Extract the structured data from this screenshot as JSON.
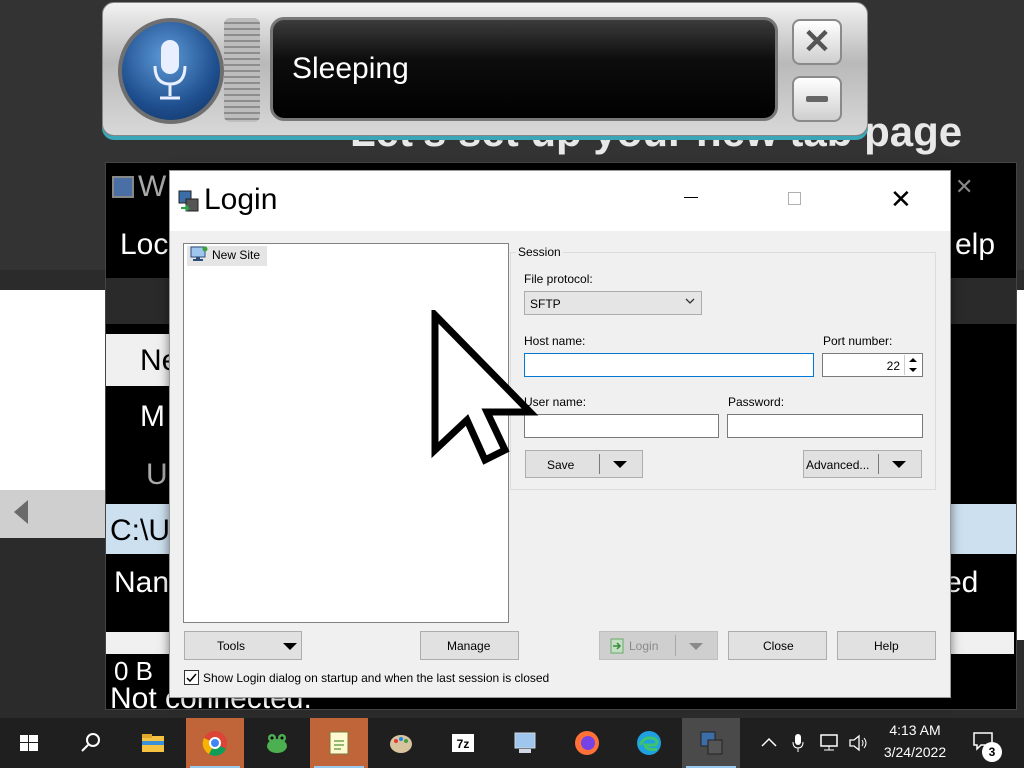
{
  "browser": {
    "heading": "Let's set up your new tab page"
  },
  "speech": {
    "status": "Sleeping"
  },
  "winscp_bg": {
    "title_fragment": "W",
    "menu_left": "Loc",
    "menu_right": "elp",
    "item_ne": "Ne",
    "item_m": "M",
    "item_u": "U",
    "path": "C:\\U",
    "col_name": "Nan",
    "col_modified": "ed",
    "size": "0 B",
    "status": "Not connected."
  },
  "login": {
    "title": "Login",
    "site_tree": {
      "items": [
        "New Site"
      ]
    },
    "session": {
      "legend": "Session",
      "file_protocol_label": "File protocol:",
      "file_protocol_value": "SFTP",
      "host_label": "Host name:",
      "host_value": "",
      "port_label": "Port number:",
      "port_value": "22",
      "user_label": "User name:",
      "user_value": "",
      "password_label": "Password:",
      "password_value": ""
    },
    "buttons": {
      "save": "Save",
      "advanced": "Advanced...",
      "tools": "Tools",
      "manage": "Manage",
      "login": "Login",
      "close": "Close",
      "help": "Help"
    },
    "startup_checkbox": {
      "label": "Show Login dialog on startup and when the last session is closed",
      "checked": true
    }
  },
  "taskbar": {
    "apps": [
      "start-icon",
      "search-icon",
      "file-explorer-icon",
      "chrome-icon",
      "frog-app-icon",
      "notepad-plus-plus-icon",
      "paint-icon",
      "7zip-icon",
      "computer-app-icon",
      "firefox-icon",
      "edge-icon",
      "winscp-icon"
    ],
    "time": "4:13 AM",
    "date": "3/24/2022",
    "notification_count": "3"
  },
  "colors": {
    "accent": "#0078d7",
    "taskbar": "#1f1f1f",
    "dialog_bg": "#f0f0f0"
  }
}
